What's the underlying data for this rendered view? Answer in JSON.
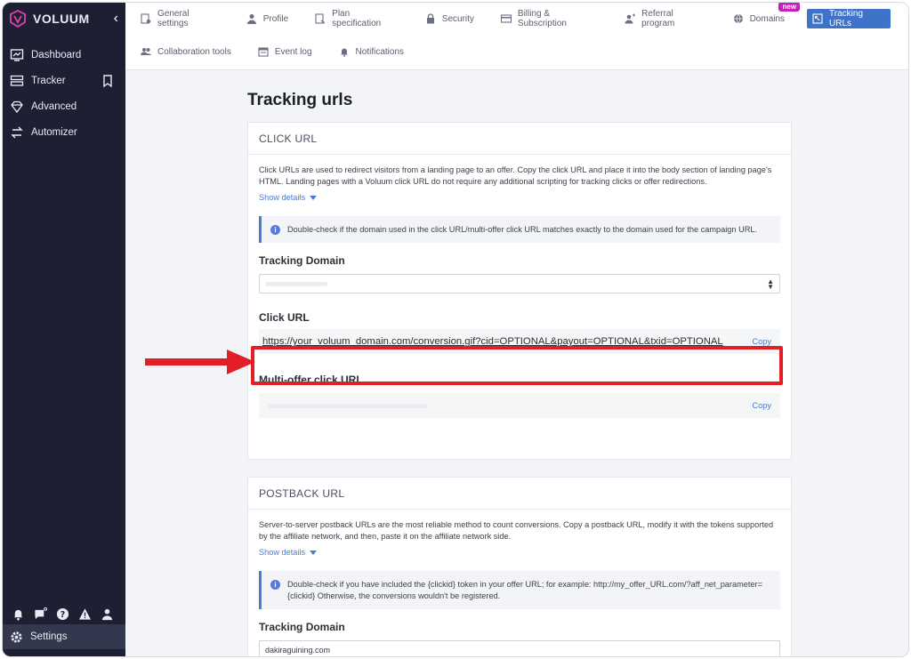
{
  "brand": {
    "name": "VOLUUM"
  },
  "sidebar": {
    "items": [
      {
        "label": "Dashboard",
        "icon": "dashboard-icon"
      },
      {
        "label": "Tracker",
        "icon": "tracker-icon"
      },
      {
        "label": "Advanced",
        "icon": "diamond-icon"
      },
      {
        "label": "Automizer",
        "icon": "automizer-icon"
      }
    ],
    "settings_label": "Settings"
  },
  "topnav": {
    "row1": [
      {
        "label": "General settings",
        "icon": "settings-doc-icon"
      },
      {
        "label": "Profile",
        "icon": "user-icon"
      },
      {
        "label": "Plan specification",
        "icon": "plan-icon"
      },
      {
        "label": "Security",
        "icon": "lock-icon"
      },
      {
        "label": "Billing & Subscription",
        "icon": "card-icon"
      },
      {
        "label": "Referral program",
        "icon": "referral-icon"
      },
      {
        "label": "Domains",
        "icon": "globe-icon",
        "badge": "new"
      },
      {
        "label": "Tracking URLs",
        "icon": "link-icon",
        "active": true
      }
    ],
    "row2": [
      {
        "label": "Collaboration tools",
        "icon": "people-icon"
      },
      {
        "label": "Event log",
        "icon": "calendar-icon"
      },
      {
        "label": "Notifications",
        "icon": "bell-icon"
      }
    ]
  },
  "page": {
    "title": "Tracking urls"
  },
  "click_card": {
    "heading": "CLICK URL",
    "description": "Click URLs are used to redirect visitors from a landing page to an offer. Copy the click URL and place it into the body section of landing page's HTML. Landing pages with a Voluum click URL do not require any additional scripting for tracking clicks or offer redirections.",
    "show_details": "Show details",
    "info": "Double-check if the domain used in the click URL/multi-offer click URL matches exactly to the domain used for the campaign URL.",
    "tracking_domain_label": "Tracking Domain",
    "click_url_label": "Click URL",
    "click_url_value": "https://your_voluum_domain.com/conversion.gif?cid=OPTIONAL&payout=OPTIONAL&txid=OPTIONAL",
    "copy_label": "Copy",
    "multi_offer_label": "Multi-offer click URL",
    "multi_copy_label": "Copy"
  },
  "postback_card": {
    "heading": "POSTBACK URL",
    "description": "Server-to-server postback URLs are the most reliable method to count conversions. Copy a postback URL, modify it with the tokens supported by the affiliate network, and then, paste it on the affiliate network side.",
    "show_details": "Show details",
    "info": "Double-check if you have included the {clickid} token in your offer URL; for example:   http://my_offer_URL.com/?aff_net_parameter={clickid}   Otherwise, the conversions wouldn't be registered.",
    "tracking_domain_label": "Tracking Domain",
    "tracking_domain_value": "dakiraguining.com"
  },
  "colors": {
    "accent": "#3f73c9",
    "highlight": "#e21f26",
    "sidebar": "#1d2033",
    "badge": "#c81eb9"
  }
}
